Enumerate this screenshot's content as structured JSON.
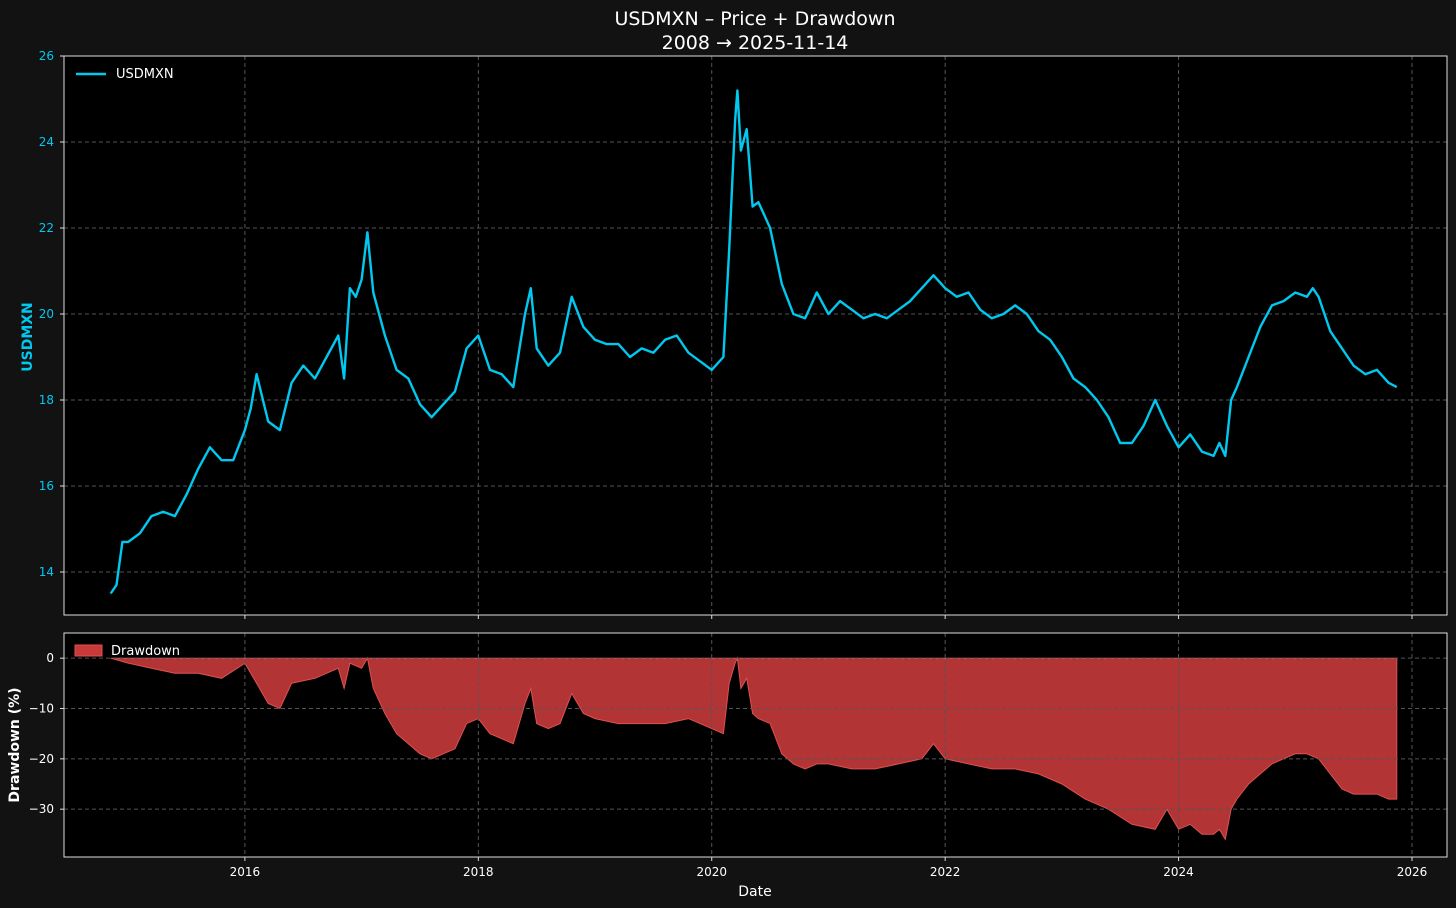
{
  "colors": {
    "figure_bg": "#121212",
    "axes_bg": "#000000",
    "price_line": "#00c8ef",
    "drawdown_fill": "#c73a3a",
    "drawdown_edge": "#e05050",
    "grid": "#555555",
    "text": "#ffffff"
  },
  "chart_data": [
    {
      "type": "line",
      "title": "USDMXN – Price + Drawdown",
      "subtitle": "2008 → 2025-11-14",
      "ylabel": "USDMXN",
      "ylim": [
        13.0,
        26.0
      ],
      "yticks": [
        14,
        16,
        18,
        20,
        22,
        24,
        26
      ],
      "yticklabels": [
        "14",
        "16",
        "18",
        "20",
        "22",
        "24",
        "26"
      ],
      "xlim": [
        2014.45,
        2026.3
      ],
      "grid": true,
      "legend_position": "upper-left",
      "series": [
        {
          "name": "USDMXN",
          "x": [
            2014.85,
            2014.9,
            2014.95,
            2015.0,
            2015.1,
            2015.2,
            2015.3,
            2015.4,
            2015.5,
            2015.6,
            2015.7,
            2015.8,
            2015.9,
            2016.0,
            2016.05,
            2016.1,
            2016.2,
            2016.3,
            2016.4,
            2016.5,
            2016.6,
            2016.7,
            2016.8,
            2016.85,
            2016.9,
            2016.95,
            2017.0,
            2017.05,
            2017.1,
            2017.2,
            2017.3,
            2017.4,
            2017.5,
            2017.6,
            2017.7,
            2017.8,
            2017.9,
            2018.0,
            2018.1,
            2018.2,
            2018.3,
            2018.4,
            2018.45,
            2018.5,
            2018.6,
            2018.7,
            2018.8,
            2018.9,
            2019.0,
            2019.1,
            2019.2,
            2019.3,
            2019.4,
            2019.5,
            2019.6,
            2019.7,
            2019.8,
            2019.9,
            2020.0,
            2020.1,
            2020.15,
            2020.2,
            2020.22,
            2020.25,
            2020.3,
            2020.35,
            2020.4,
            2020.45,
            2020.5,
            2020.6,
            2020.7,
            2020.8,
            2020.9,
            2021.0,
            2021.1,
            2021.2,
            2021.3,
            2021.4,
            2021.5,
            2021.6,
            2021.7,
            2021.8,
            2021.9,
            2022.0,
            2022.1,
            2022.2,
            2022.3,
            2022.4,
            2022.5,
            2022.6,
            2022.7,
            2022.8,
            2022.9,
            2023.0,
            2023.1,
            2023.2,
            2023.3,
            2023.4,
            2023.5,
            2023.6,
            2023.7,
            2023.8,
            2023.9,
            2024.0,
            2024.1,
            2024.2,
            2024.3,
            2024.35,
            2024.4,
            2024.45,
            2024.5,
            2024.6,
            2024.7,
            2024.8,
            2024.9,
            2025.0,
            2025.1,
            2025.15,
            2025.2,
            2025.3,
            2025.4,
            2025.5,
            2025.6,
            2025.7,
            2025.8,
            2025.87
          ],
          "y": [
            13.5,
            13.7,
            14.7,
            14.7,
            14.9,
            15.3,
            15.4,
            15.3,
            15.8,
            16.4,
            16.9,
            16.6,
            16.6,
            17.3,
            17.8,
            18.6,
            17.5,
            17.3,
            18.4,
            18.8,
            18.5,
            19.0,
            19.5,
            18.5,
            20.6,
            20.4,
            20.8,
            21.9,
            20.5,
            19.5,
            18.7,
            18.5,
            17.9,
            17.6,
            17.9,
            18.2,
            19.2,
            19.5,
            18.7,
            18.6,
            18.3,
            20.0,
            20.6,
            19.2,
            18.8,
            19.1,
            20.4,
            19.7,
            19.4,
            19.3,
            19.3,
            19.0,
            19.2,
            19.1,
            19.4,
            19.5,
            19.1,
            18.9,
            18.7,
            19.0,
            21.5,
            24.5,
            25.2,
            23.8,
            24.3,
            22.5,
            22.6,
            22.3,
            22.0,
            20.7,
            20.0,
            19.9,
            20.5,
            20.0,
            20.3,
            20.1,
            19.9,
            20.0,
            19.9,
            20.1,
            20.3,
            20.6,
            20.9,
            20.6,
            20.4,
            20.5,
            20.1,
            19.9,
            20.0,
            20.2,
            20.0,
            19.6,
            19.4,
            19.0,
            18.5,
            18.3,
            18.0,
            17.6,
            17.0,
            17.0,
            17.4,
            18.0,
            17.4,
            16.9,
            17.2,
            16.8,
            16.7,
            17.0,
            16.7,
            18.0,
            18.3,
            19.0,
            19.7,
            20.2,
            20.3,
            20.5,
            20.4,
            20.6,
            20.4,
            19.6,
            19.2,
            18.8,
            18.6,
            18.7,
            18.4,
            18.3
          ]
        }
      ]
    },
    {
      "type": "area",
      "xlabel": "Date",
      "ylabel": "Drawdown (%)",
      "ylim": [
        -39.5,
        5.0
      ],
      "yticks": [
        0,
        -10,
        -20,
        -30
      ],
      "yticklabels": [
        "0",
        "−10",
        "−20",
        "−30"
      ],
      "xlim": [
        2014.45,
        2026.3
      ],
      "xticks": [
        2016,
        2018,
        2020,
        2022,
        2024,
        2026
      ],
      "xticklabels": [
        "2016",
        "2018",
        "2020",
        "2022",
        "2024",
        "2026"
      ],
      "grid": true,
      "legend_position": "upper-left",
      "series": [
        {
          "name": "Drawdown",
          "x": [
            2014.85,
            2015.0,
            2015.2,
            2015.4,
            2015.6,
            2015.8,
            2016.0,
            2016.1,
            2016.2,
            2016.3,
            2016.4,
            2016.6,
            2016.8,
            2016.85,
            2016.9,
            2017.0,
            2017.05,
            2017.1,
            2017.2,
            2017.3,
            2017.4,
            2017.5,
            2017.6,
            2017.7,
            2017.8,
            2017.9,
            2018.0,
            2018.1,
            2018.2,
            2018.3,
            2018.4,
            2018.45,
            2018.5,
            2018.6,
            2018.7,
            2018.8,
            2018.9,
            2019.0,
            2019.2,
            2019.4,
            2019.6,
            2019.8,
            2020.0,
            2020.1,
            2020.15,
            2020.2,
            2020.22,
            2020.25,
            2020.3,
            2020.35,
            2020.4,
            2020.5,
            2020.6,
            2020.7,
            2020.8,
            2020.9,
            2021.0,
            2021.2,
            2021.4,
            2021.6,
            2021.8,
            2021.9,
            2022.0,
            2022.2,
            2022.4,
            2022.6,
            2022.8,
            2023.0,
            2023.2,
            2023.4,
            2023.6,
            2023.8,
            2023.9,
            2024.0,
            2024.1,
            2024.2,
            2024.3,
            2024.35,
            2024.4,
            2024.45,
            2024.5,
            2024.6,
            2024.7,
            2024.8,
            2024.9,
            2025.0,
            2025.1,
            2025.2,
            2025.3,
            2025.4,
            2025.5,
            2025.6,
            2025.7,
            2025.8,
            2025.87
          ],
          "y": [
            0,
            -1,
            -2,
            -3,
            -3,
            -4,
            -1,
            -5,
            -9,
            -10,
            -5,
            -4,
            -2,
            -6,
            -1,
            -2,
            0,
            -6,
            -11,
            -15,
            -17,
            -19,
            -20,
            -19,
            -18,
            -13,
            -12,
            -15,
            -16,
            -17,
            -9,
            -6,
            -13,
            -14,
            -13,
            -7,
            -11,
            -12,
            -13,
            -13,
            -13,
            -12,
            -14,
            -15,
            -5,
            -1,
            0,
            -6,
            -4,
            -11,
            -12,
            -13,
            -19,
            -21,
            -22,
            -21,
            -21,
            -22,
            -22,
            -21,
            -20,
            -17,
            -20,
            -21,
            -22,
            -22,
            -23,
            -25,
            -28,
            -30,
            -33,
            -34,
            -30,
            -34,
            -33,
            -35,
            -35,
            -34,
            -36,
            -30,
            -28,
            -25,
            -23,
            -21,
            -20,
            -19,
            -19,
            -20,
            -23,
            -26,
            -27,
            -27,
            -27,
            -28,
            -28
          ]
        }
      ]
    }
  ]
}
